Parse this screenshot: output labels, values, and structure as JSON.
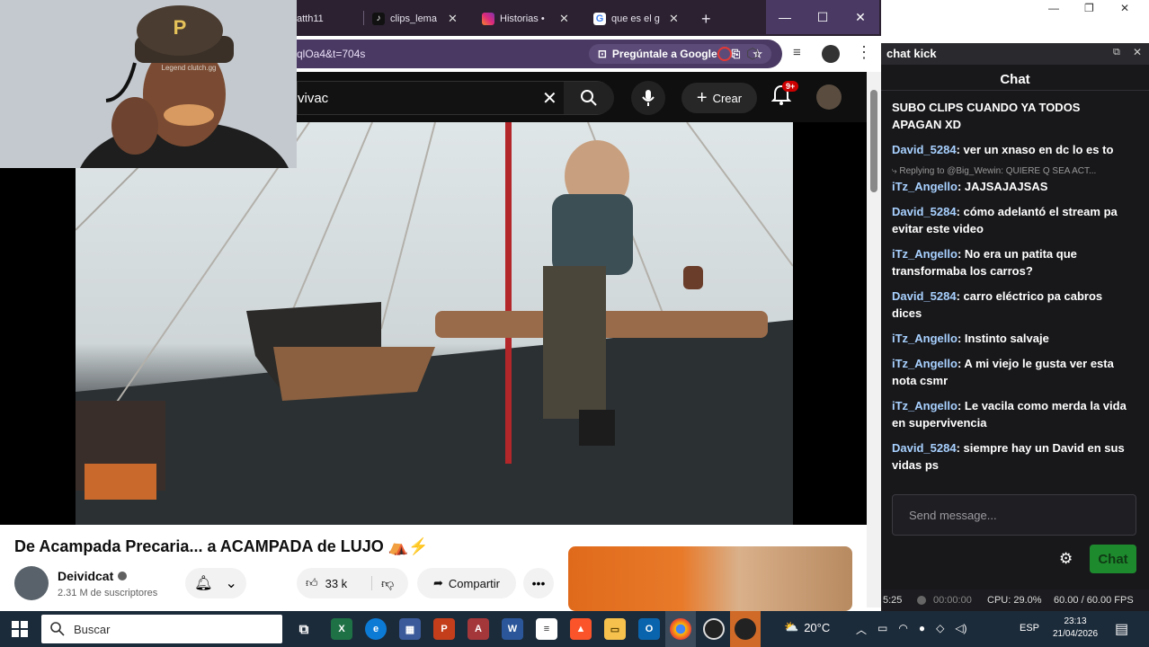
{
  "browser": {
    "tabs": [
      {
        "label": "atth11",
        "color": "#9146ff"
      },
      {
        "label": "clips_lema",
        "color": "#000000"
      },
      {
        "label": "Historias •",
        "color": "#e1306c"
      },
      {
        "label": "que es el g",
        "color": "#4285f4"
      }
    ],
    "new_tab": "+",
    "url": "qlOa4&t=704s",
    "ask_google": "Pregúntale a Google",
    "window_controls": {
      "minimize": "—",
      "maximize": "☐",
      "close": "✕"
    }
  },
  "youtube": {
    "search_value": "vivac",
    "create_label": "Crear",
    "notifications_badge": "9+",
    "video_title": "De Acampada Precaria... a ACAMPADA de LUJO ⛺⚡",
    "channel_name": "Deividcat",
    "subscribers": "2.31 M de suscriptores",
    "likes": "33 k",
    "share_label": "Compartir"
  },
  "webcam": {
    "cap_text": "Legend clutch.gg",
    "hat_logo": "P"
  },
  "chat": {
    "window_title": "chat kick",
    "title": "Chat",
    "top_message": "SUBO CLIPS CUANDO YA TODOS APAGAN XD",
    "messages": [
      {
        "user": "David_5284",
        "text": "ver un xnaso en dc lo es to"
      },
      {
        "reply": "Replying to @Big_Wewin: QUIERE Q SEA ACT...",
        "user": "iTz_Angello",
        "text": "JAJSAJAJSAS"
      },
      {
        "user": "David_5284",
        "text": "cómo adelantó el stream pa evitar este video"
      },
      {
        "user": "iTz_Angello",
        "text": "No era un patita que transformaba los carros?"
      },
      {
        "user": "David_5284",
        "text": "carro eléctrico pa cabros dices"
      },
      {
        "user": "iTz_Angello",
        "text": "Instinto salvaje"
      },
      {
        "user": "iTz_Angello",
        "text": "A mi viejo le gusta ver esta nota csmr"
      },
      {
        "user": "iTz_Angello",
        "text": "Le vacila como merda la vida en supervivencia"
      },
      {
        "user": "David_5284",
        "text": "siempre hay un David en sus vidas ps"
      }
    ],
    "input_placeholder": "Send message...",
    "send_label": "Chat"
  },
  "obs_status": {
    "time_left": "5:25",
    "rec_time": "00:00:00",
    "cpu": "CPU: 29.0%",
    "fps": "60.00 / 60.00 FPS"
  },
  "taskbar": {
    "search_label": "Buscar",
    "weather": "20°C",
    "language": "ESP",
    "time": "23:13",
    "date": "21/04/2026"
  }
}
